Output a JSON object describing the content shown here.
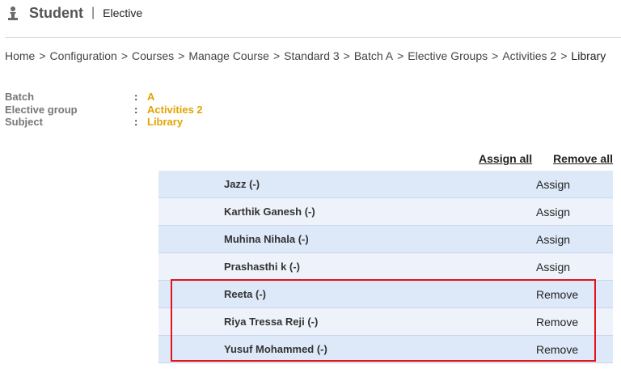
{
  "header": {
    "title": "Student",
    "separator": "|",
    "subtitle": "Elective",
    "icon": "student-logo-icon"
  },
  "breadcrumb": [
    "Home",
    "Configuration",
    "Courses",
    "Manage Course",
    "Standard 3",
    "Batch A",
    "Elective Groups",
    "Activities 2",
    "Library"
  ],
  "breadcrumb_separator": ">",
  "info": {
    "colon": ":",
    "batch": {
      "label": "Batch",
      "value": "A"
    },
    "elective_group": {
      "label": "Elective group",
      "value": "Activities 2"
    },
    "subject": {
      "label": "Subject",
      "value": "Library"
    }
  },
  "actions": {
    "assign_all": "Assign all",
    "remove_all": "Remove all"
  },
  "students": [
    {
      "name": "Jazz (-)",
      "action": "Assign"
    },
    {
      "name": "Karthik Ganesh (-)",
      "action": "Assign"
    },
    {
      "name": "Muhina Nihala (-)",
      "action": "Assign"
    },
    {
      "name": "Prashasthi k (-)",
      "action": "Assign"
    },
    {
      "name": "Reeta (-)",
      "action": "Remove"
    },
    {
      "name": "Riya Tressa Reji (-)",
      "action": "Remove"
    },
    {
      "name": "Yusuf Mohammed (-)",
      "action": "Remove"
    }
  ],
  "colors": {
    "value_text": "#e2a400",
    "row_odd": "#dde8f8",
    "row_even": "#eef3fb",
    "highlight_border": "#e0161b"
  }
}
